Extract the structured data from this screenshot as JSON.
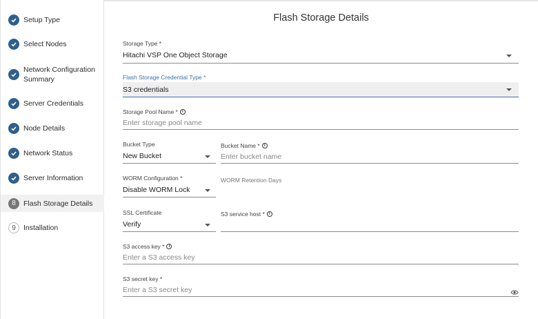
{
  "steps": [
    {
      "label": "Setup Type",
      "state": "done"
    },
    {
      "label": "Select Nodes",
      "state": "done"
    },
    {
      "label": "Network Configuration",
      "label2": "Summary",
      "state": "done"
    },
    {
      "label": "Server Credentials",
      "state": "done"
    },
    {
      "label": "Node Details",
      "state": "done"
    },
    {
      "label": "Network Status",
      "state": "done"
    },
    {
      "label": "Server Information",
      "state": "done"
    },
    {
      "label": "Flash Storage Details",
      "state": "current",
      "number": "8"
    },
    {
      "label": "Installation",
      "state": "pending",
      "number": "9"
    }
  ],
  "page": {
    "title": "Flash Storage Details"
  },
  "form": {
    "storage_type": {
      "label": "Storage Type *",
      "value": "Hitachi VSP One Object Storage"
    },
    "credential_type": {
      "label": "Flash Storage Credential Type *",
      "value": "S3 credentials"
    },
    "storage_pool": {
      "label": "Storage Pool Name *",
      "placeholder": "Enter storage pool name"
    },
    "bucket_type": {
      "label": "Bucket Type",
      "value": "New Bucket"
    },
    "bucket_name": {
      "label": "Bucket Name *",
      "placeholder": "Enter bucket name"
    },
    "worm_config": {
      "label": "WORM Configuration *",
      "value": "Disable WORM Lock"
    },
    "worm_retention": {
      "label": "WORM Retention Days"
    },
    "ssl_cert": {
      "label": "SSL Certificate",
      "value": "Verify"
    },
    "s3_host": {
      "label": "S3 service host *"
    },
    "s3_access": {
      "label": "S3 access key *",
      "placeholder": "Enter a S3 access key"
    },
    "s3_secret": {
      "label": "S3 secret key *",
      "placeholder": "Enter a S3 secret key"
    }
  },
  "icons": {
    "check": "check-icon",
    "info": "info-icon",
    "caret": "caret-down-icon",
    "eye": "eye-icon"
  }
}
